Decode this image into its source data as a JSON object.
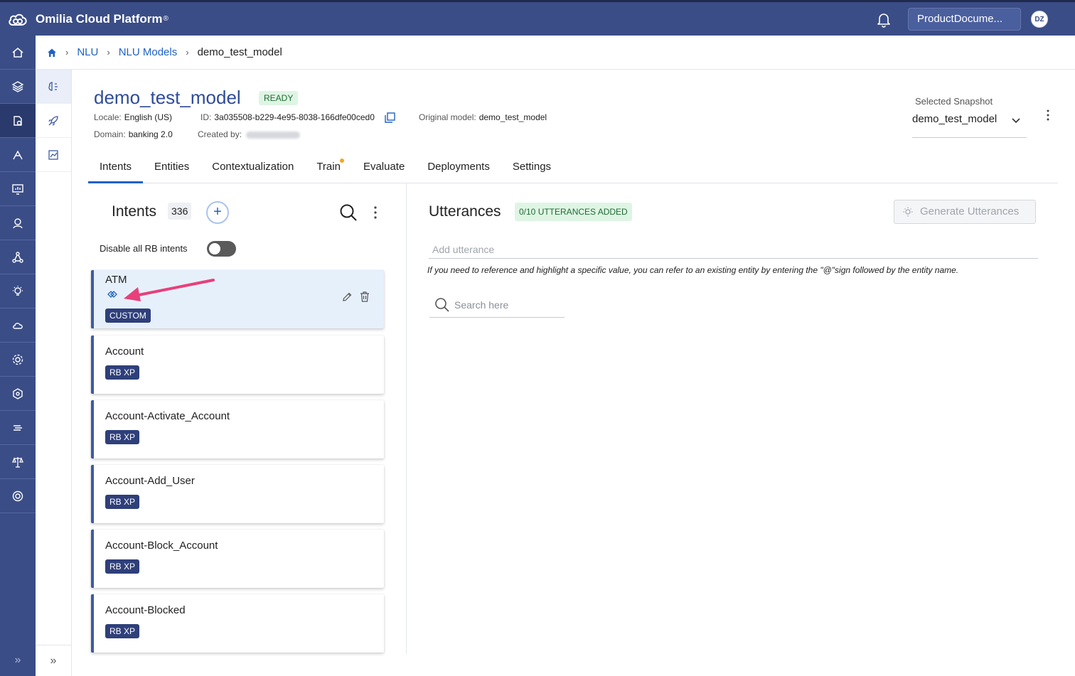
{
  "app": {
    "brand": "Omilia Cloud Platform",
    "brand_mark": "®",
    "account_label": "ProductDocume...",
    "avatar_initials": "DZ"
  },
  "breadcrumb": {
    "items": [
      "NLU",
      "NLU Models"
    ],
    "current": "demo_test_model"
  },
  "model": {
    "title": "demo_test_model",
    "status": "READY",
    "locale_label": "Locale:",
    "locale_value": "English (US)",
    "id_label": "ID:",
    "id_value": "3a035508-b229-4e95-8038-166dfe00ced0",
    "original_label": "Original model:",
    "original_value": "demo_test_model",
    "domain_label": "Domain:",
    "domain_value": "banking 2.0",
    "created_label": "Created by:"
  },
  "snapshot": {
    "label": "Selected Snapshot",
    "value": "demo_test_model"
  },
  "tabs": [
    {
      "label": "Intents",
      "active": true
    },
    {
      "label": "Entities"
    },
    {
      "label": "Contextualization"
    },
    {
      "label": "Train",
      "has_dot": true
    },
    {
      "label": "Evaluate"
    },
    {
      "label": "Deployments"
    },
    {
      "label": "Settings"
    }
  ],
  "intents": {
    "title": "Intents",
    "count": "336",
    "toggle_label": "Disable all RB intents",
    "items": [
      {
        "name": "ATM",
        "tag": "CUSTOM",
        "selected": true
      },
      {
        "name": "Account",
        "tag": "RB XP"
      },
      {
        "name": "Account-Activate_Account",
        "tag": "RB XP"
      },
      {
        "name": "Account-Add_User",
        "tag": "RB XP"
      },
      {
        "name": "Account-Block_Account",
        "tag": "RB XP"
      },
      {
        "name": "Account-Blocked",
        "tag": "RB XP"
      }
    ]
  },
  "utterances": {
    "title": "Utterances",
    "badge": "0/10 UTTERANCES ADDED",
    "generate_label": "Generate Utterances",
    "add_placeholder": "Add utterance",
    "hint": "If you need to reference and highlight a specific value, you can refer to an existing entity by entering the \"@\"sign followed by the entity name.",
    "search_placeholder": "Search here"
  },
  "colors": {
    "topbar": "#3a4d86",
    "accent": "#1e62c4",
    "tag": "#2e3f7a",
    "annotation_arrow": "#e8407a"
  }
}
